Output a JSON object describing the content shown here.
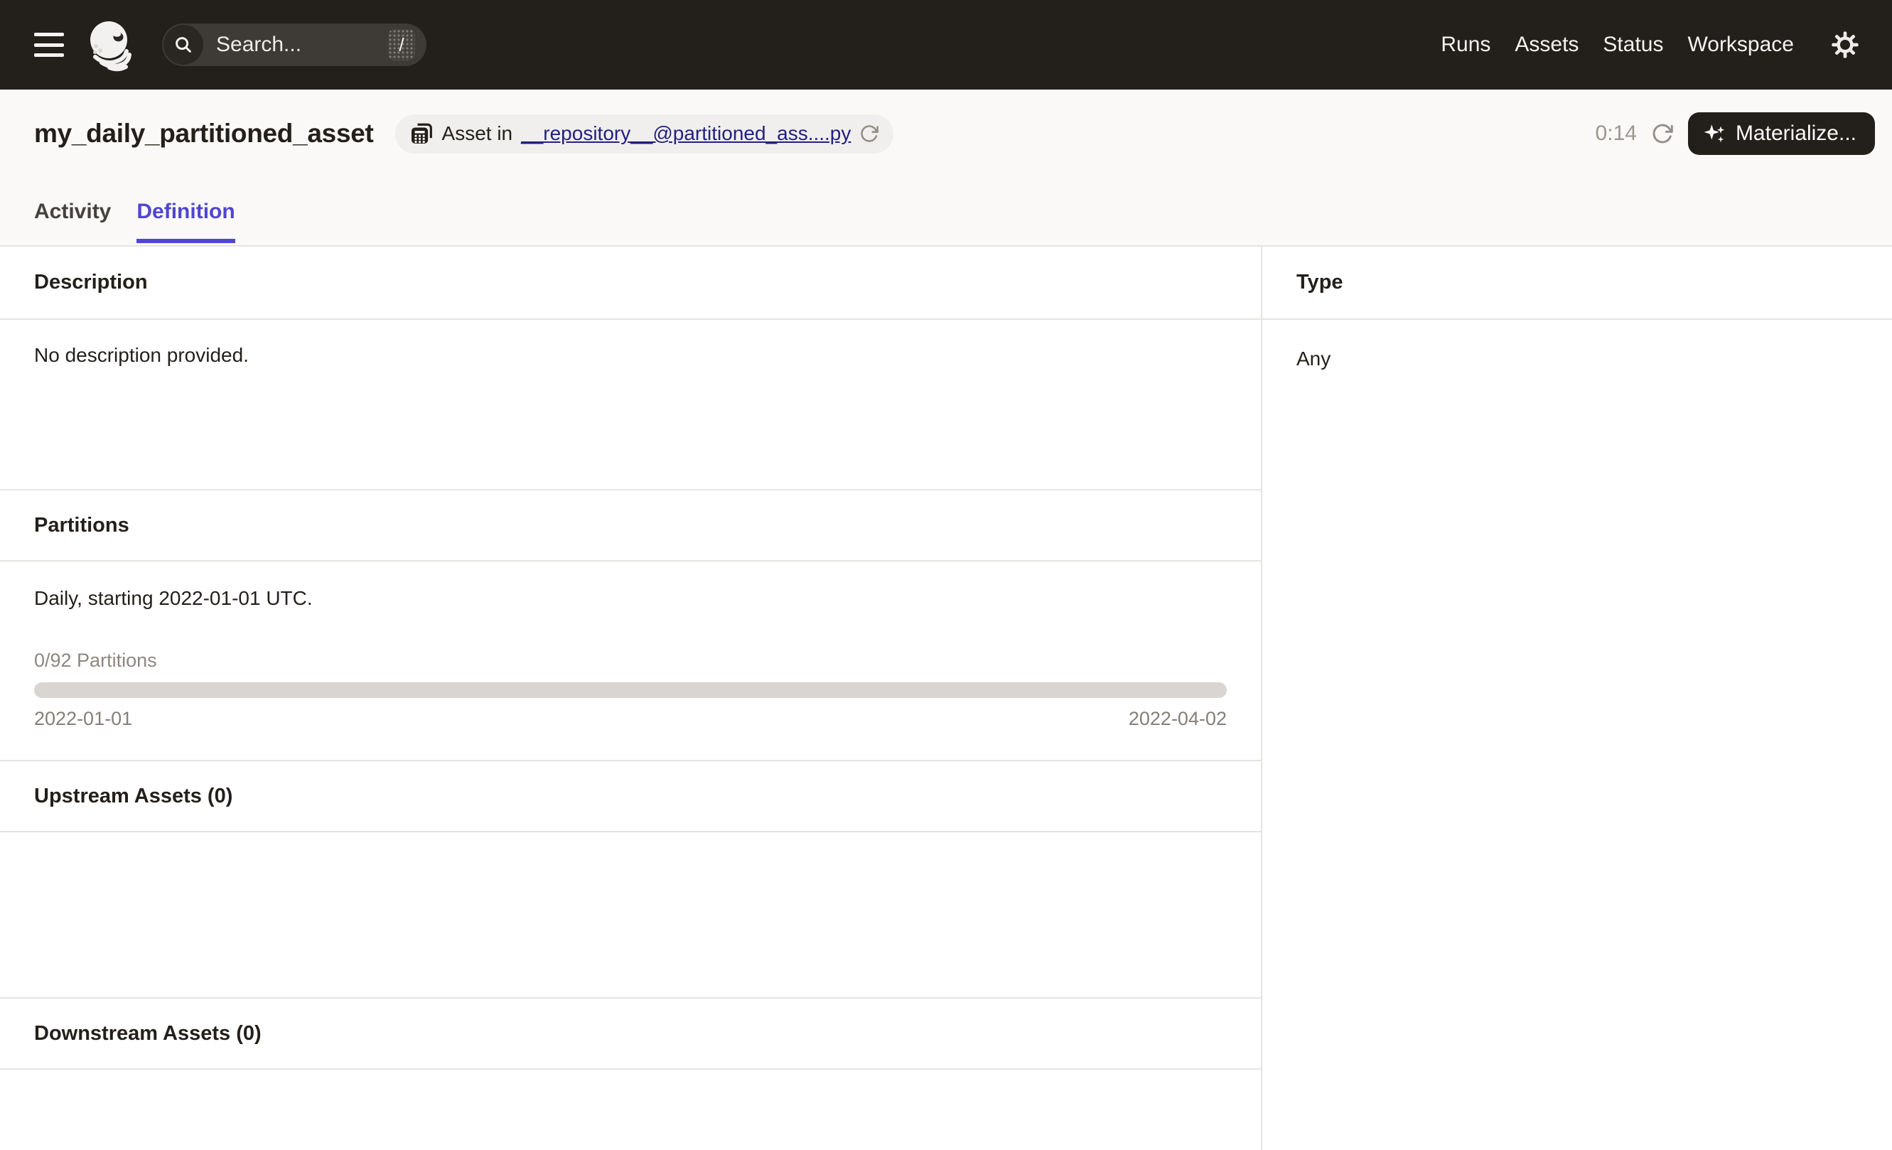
{
  "header": {
    "search_placeholder": "Search...",
    "search_shortcut": "/",
    "nav": [
      "Runs",
      "Assets",
      "Status",
      "Workspace"
    ]
  },
  "title_bar": {
    "title": "my_daily_partitioned_asset",
    "asset_location_prefix": "Asset in",
    "asset_location_link": "__repository__@partitioned_ass....py",
    "timer": "0:14",
    "materialize_label": "Materialize..."
  },
  "tabs": [
    {
      "label": "Activity",
      "active": false
    },
    {
      "label": "Definition",
      "active": true
    }
  ],
  "sections": {
    "description": {
      "heading": "Description",
      "body": "No description provided."
    },
    "partitions": {
      "heading": "Partitions",
      "summary": "Daily, starting 2022-01-01 UTC.",
      "progress_label": "0/92 Partitions",
      "progress_percent": 0,
      "range_start": "2022-01-01",
      "range_end": "2022-04-02"
    },
    "upstream": {
      "heading": "Upstream Assets (0)"
    },
    "downstream": {
      "heading": "Downstream Assets (0)"
    },
    "type": {
      "heading": "Type",
      "value": "Any"
    }
  },
  "colors": {
    "topbar_bg": "#231F1B",
    "accent_indigo": "#5045D2",
    "link_navy": "#232180",
    "border": "#E6E4E1",
    "muted_text": "#8D8780",
    "progress_track": "#D8D5D2"
  }
}
